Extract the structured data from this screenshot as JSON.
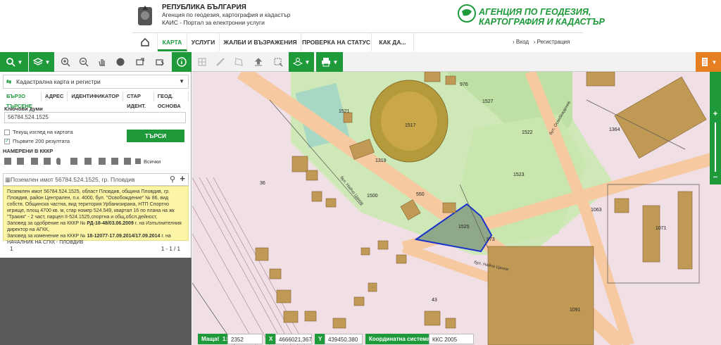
{
  "header": {
    "brand_line1": "РЕПУБЛИКА БЪЛГАРИЯ",
    "brand_line2": "Агенция по геодезия, картография и кадастър",
    "brand_line3": "КАИС - Портал за електронни услуги",
    "agency_line1": "АГЕНЦИЯ ПО ГЕОДЕЗИЯ,",
    "agency_line2": "КАРТОГРАФИЯ И КАДАСТЪР"
  },
  "nav": {
    "items": [
      "КАРТА",
      "УСЛУГИ",
      "ЖАЛБИ И ВЪЗРАЖЕНИЯ",
      "ПРОВЕРКА НА СТАТУС",
      "КАК ДА..."
    ],
    "login": "Вход",
    "register": "Регистрация"
  },
  "sidebar": {
    "layer_select": "Кадастрална карта и регистри",
    "tabs": [
      "БЪРЗО ТЪРСЕНЕ",
      "АДРЕС",
      "ИДЕНТИФИКАТОР",
      "СТАР ИДЕНТ.",
      "ГЕОД. ОСНОВА"
    ],
    "keywords_label": "Ключови думи",
    "keywords_value": "56784.524.1525",
    "check_current_view": "Текущ изглед на картата",
    "check_first_200": "Първите 200 резултата",
    "search_button": "ТЪРСИ",
    "found_label": "НАМЕРЕНИ В КККР",
    "filter_all": "Всички",
    "result_title": "Поземлен имот 56784.524.1525, гр. Пловдив",
    "result_p1": "Поземлен имот 56784.524.1525, област Пловдив, община Пловдив, гр. Пловдив, район Централен, п.к. 4000, бул. \"Освобождение\" № 86, вид собств. Общинска частна, вид територия Урбанизирана, НТП Спортно игрище, площ 4700 кв. м, стар номер 524.549, квартал 16 по плана на жк \"Тракия\" - 2 част, парцел II-524.1525,спортна и общ.обсл.дейност,",
    "result_p2a": "Заповед за одобрение на КККР №",
    "result_p2b": "РД-18-48/03.06.2009",
    "result_p2c": "г. на Изпълнителния директор на АГКК,",
    "result_p3a": "Заповед за изменение на КККР №",
    "result_p3b": "18-12077-17.09.2014/17.09.2014",
    "result_p3c": "г. на НАЧАЛНИК НА СГКК - ПЛОВДИВ",
    "page_num": "1",
    "page_range": "1 - 1 / 1"
  },
  "status_bar": {
    "scale_label": "Мащаб",
    "scale_prefix": "1:",
    "scale_value": "2352",
    "x_label": "X",
    "x_value": "4666021,367",
    "y_label": "Y",
    "y_value": "439450,380",
    "crs_label": "Координатна система",
    "crs_value": "ККС 2005"
  },
  "map": {
    "parcel_labels": [
      "1521",
      "1517",
      "1527",
      "976",
      "1319",
      "1500",
      "550",
      "1525",
      "1522",
      "1523",
      "1364",
      "1063",
      "1071",
      "1091",
      "36",
      "43",
      "973"
    ],
    "street_labels": [
      "бул. Освобождение",
      "бул. Найчо Цанов",
      "бул. Найчо Цанов"
    ]
  }
}
